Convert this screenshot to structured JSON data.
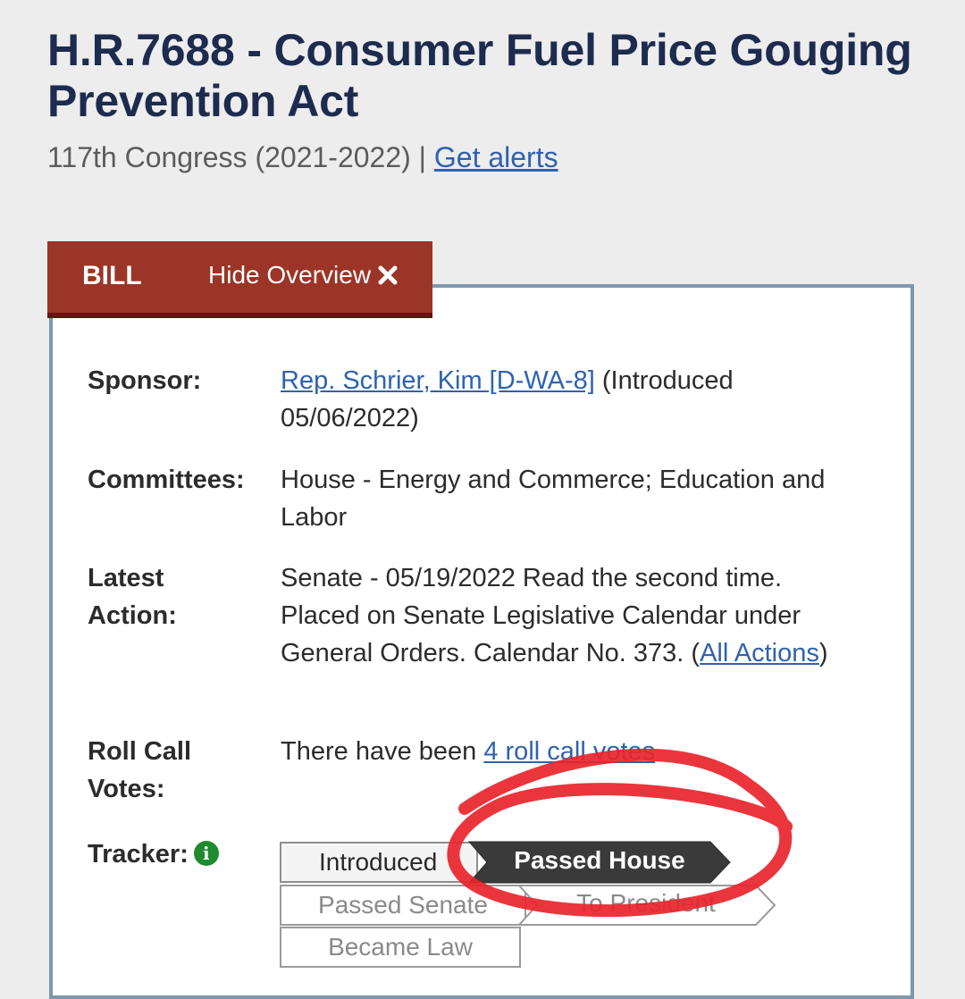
{
  "bill": {
    "title": "H.R.7688 - Consumer Fuel Price Gouging Prevention Act",
    "congress": "117th Congress (2021-2022)",
    "separator": "|",
    "alerts_link": "Get alerts"
  },
  "tabs": {
    "bill_label": "BILL",
    "hide_overview_label": "Hide Overview"
  },
  "overview": {
    "sponsor": {
      "label": "Sponsor:",
      "name": "Rep. Schrier, Kim [D-WA-8]",
      "introduced": "(Introduced 05/06/2022)"
    },
    "committees": {
      "label": "Committees:",
      "value": "House - Energy and Commerce; Education and Labor"
    },
    "latest_action": {
      "label_line1": "Latest",
      "label_line2": "Action:",
      "text": "Senate - 05/19/2022 Read the second time. Placed on Senate Legislative Calendar under General Orders. Calendar No. 373.",
      "link_prefix": "(",
      "link": "All Actions",
      "link_suffix": ")"
    },
    "roll_call": {
      "label_line1": "Roll Call",
      "label_line2": "Votes:",
      "prefix": "There have been",
      "link": "4 roll call votes"
    },
    "tracker": {
      "label": "Tracker:",
      "info_icon": "info-icon",
      "steps": [
        {
          "label": "Introduced",
          "state": "completed"
        },
        {
          "label": "Passed House",
          "state": "current"
        },
        {
          "label": "Passed Senate",
          "state": "future"
        },
        {
          "label": "To President",
          "state": "future"
        },
        {
          "label": "Became Law",
          "state": "future"
        }
      ]
    }
  },
  "colors": {
    "title": "#1d2b4e",
    "tab_background": "#9b3527",
    "link": "#2f62b0",
    "current_step": "#3a3a3a",
    "annotation": "#e8242b"
  }
}
